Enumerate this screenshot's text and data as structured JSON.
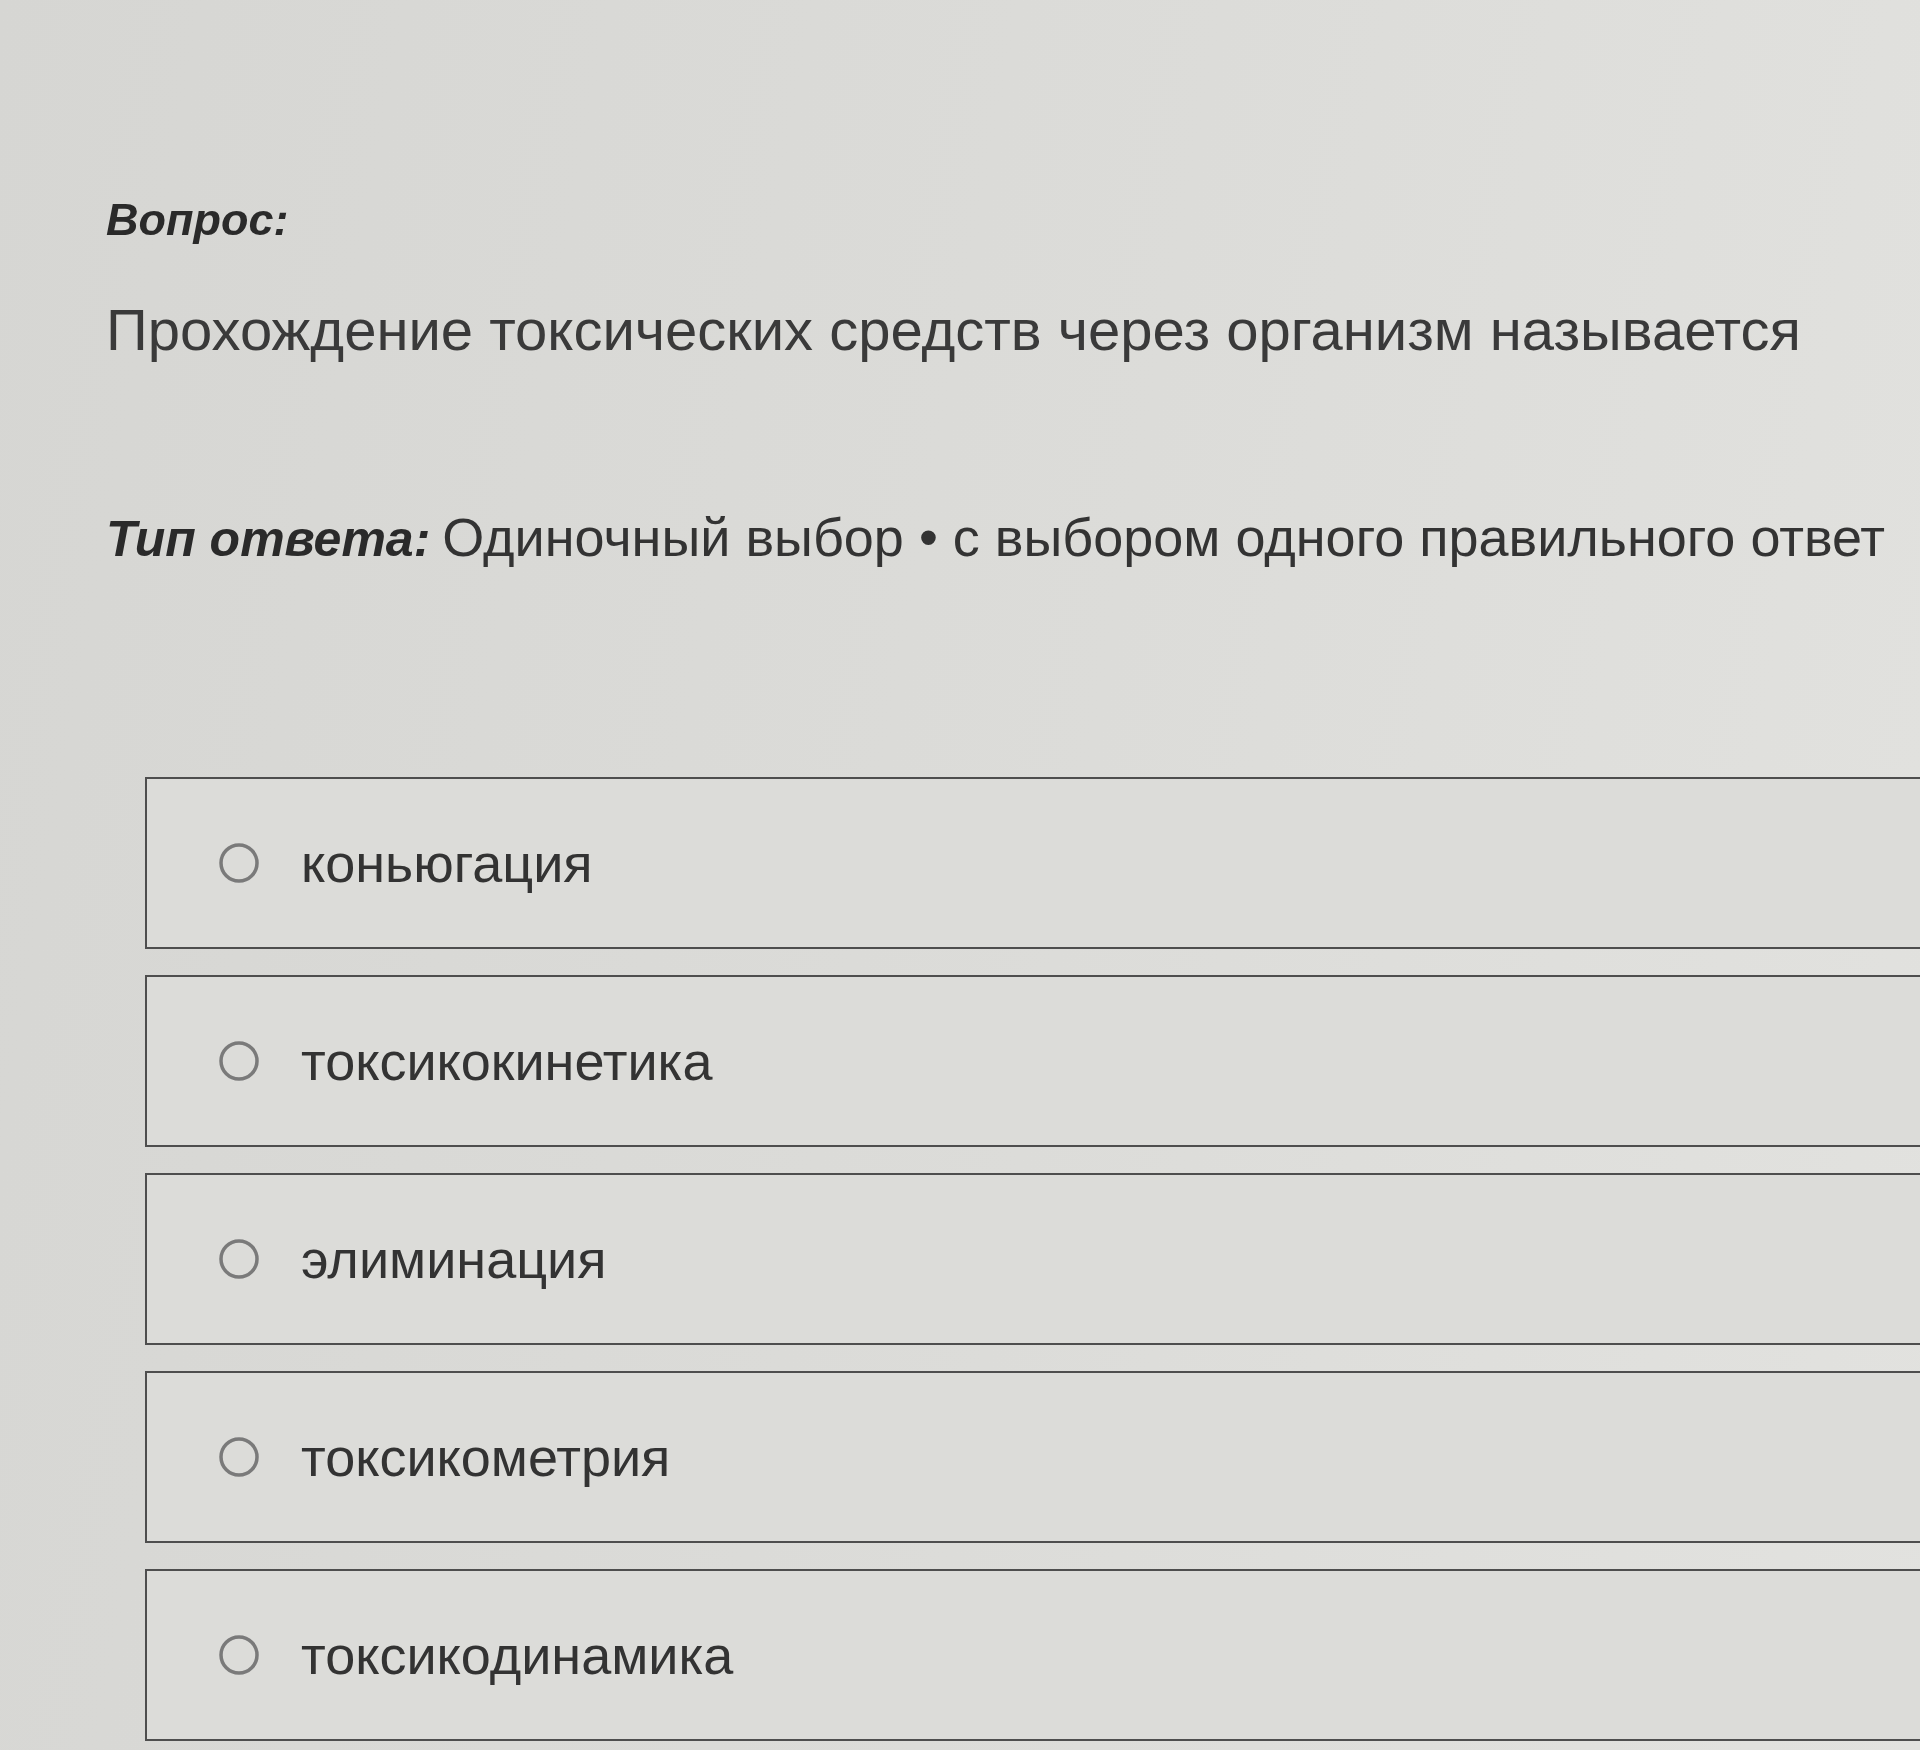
{
  "question": {
    "heading": "Вопрос:",
    "text": "Прохождение токсических средств через организм называется"
  },
  "answer_type": {
    "label": "Тип ответа:",
    "value": "Одиночный выбор • с выбором одного правильного ответ"
  },
  "options": [
    {
      "label": "коньюгация",
      "selected": false
    },
    {
      "label": "токсикокинетика",
      "selected": false
    },
    {
      "label": "элиминация",
      "selected": false
    },
    {
      "label": "токсикометрия",
      "selected": false
    },
    {
      "label": "токсикодинамика",
      "selected": false
    }
  ]
}
